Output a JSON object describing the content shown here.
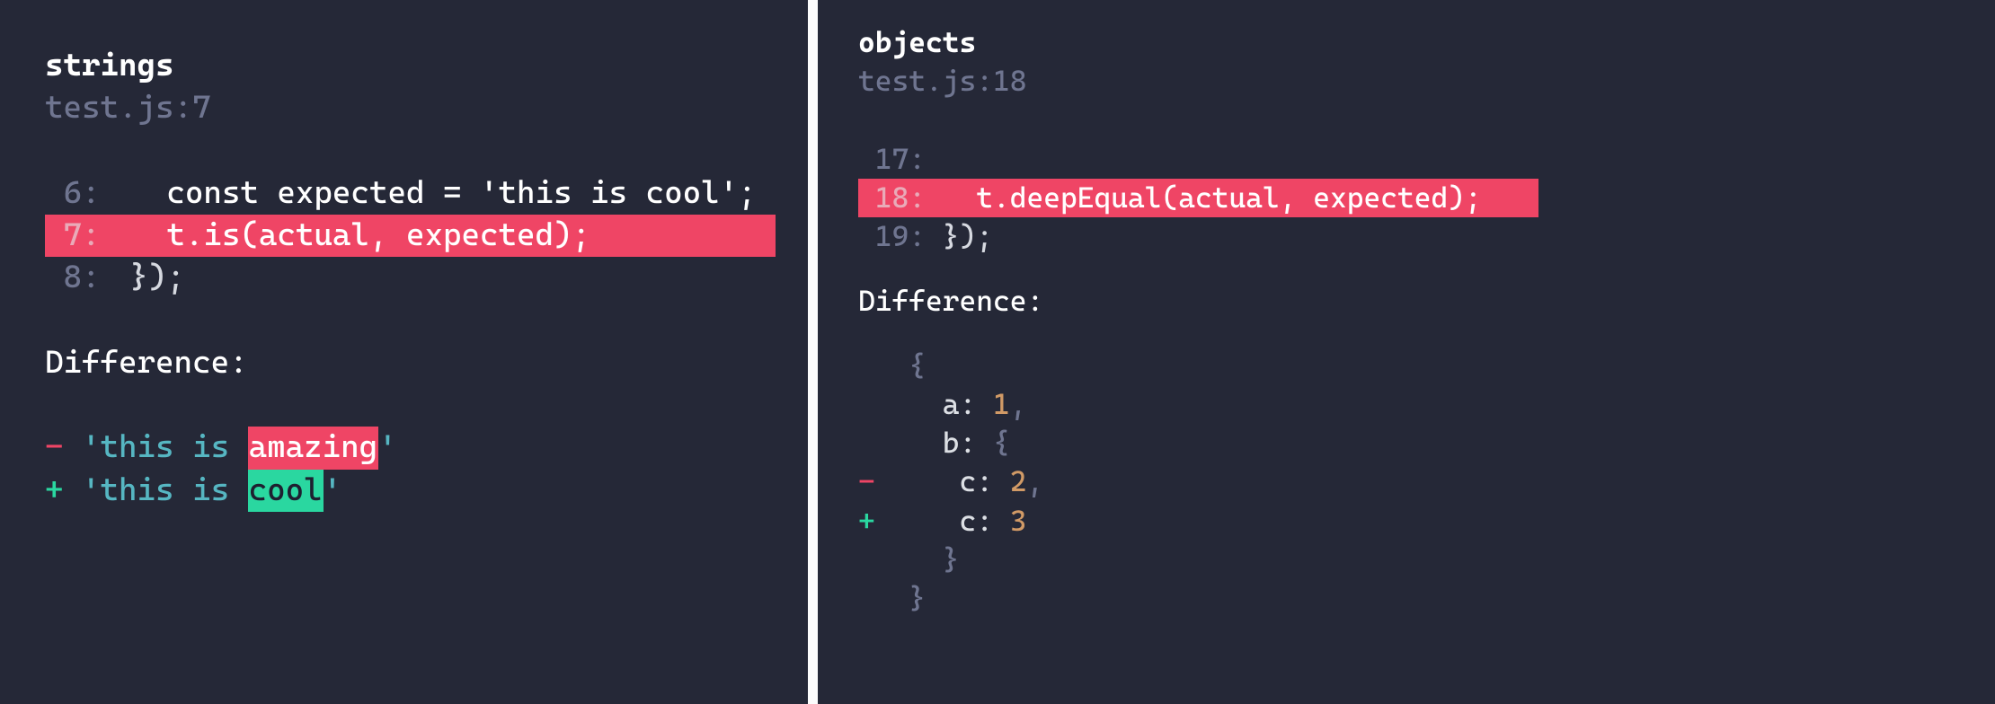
{
  "left": {
    "title": "strings",
    "location": "test.js:7",
    "code": [
      {
        "n": "6:",
        "text": "   const expected = 'this is cool';",
        "hl": false
      },
      {
        "n": "7:",
        "text": "   t.is(actual, expected);",
        "hl": true
      },
      {
        "n": "8:",
        "text": "});",
        "hl": false
      }
    ],
    "difference_label": "Difference:",
    "diff": {
      "minus": {
        "sign": "-",
        "pad": " ",
        "q1": "'",
        "pre": "this is ",
        "chg": "amazing",
        "q2": "'"
      },
      "plus": {
        "sign": "+",
        "pad": " ",
        "q1": "'",
        "pre": "this is ",
        "chg": "cool",
        "q2": "'"
      }
    }
  },
  "right": {
    "title": "objects",
    "location": "test.js:18",
    "code": [
      {
        "n": "17:",
        "text": "",
        "hl": false
      },
      {
        "n": "18:",
        "text": "   t.deepEqual(actual, expected);",
        "hl": true
      },
      {
        "n": "19:",
        "text": "});",
        "hl": false
      }
    ],
    "difference_label": "Difference:",
    "obj": {
      "open": "  {",
      "a": {
        "pad": "    ",
        "key": "a: ",
        "val": "1",
        "comma": ","
      },
      "bopen": {
        "pad": "    ",
        "key": "b: ",
        "brace": "{"
      },
      "cminus": {
        "sign": "-",
        "pad": "     ",
        "key": "c: ",
        "val": "2",
        "comma": ","
      },
      "cplus": {
        "sign": "+",
        "pad": "     ",
        "key": "c: ",
        "val": "3"
      },
      "bclose": "    }",
      "close": "  }"
    }
  }
}
